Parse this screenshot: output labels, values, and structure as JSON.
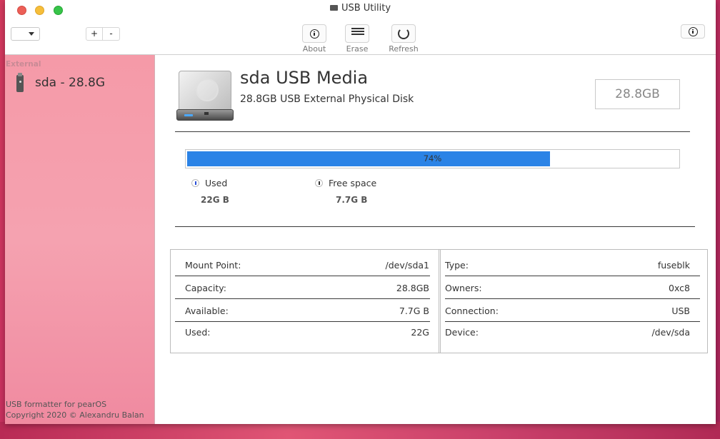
{
  "window": {
    "title": "USB Utility"
  },
  "toolbar": {
    "plus_label": "+",
    "minus_label": "-",
    "about_label": "About",
    "erase_label": "Erase",
    "refresh_label": "Refresh"
  },
  "sidebar": {
    "section_title": "External",
    "devices": [
      {
        "label": "sda - 28.8G"
      }
    ],
    "footer_line1": "USB formatter for pearOS",
    "footer_line2": "Copyright 2020 © Alexandru Balan"
  },
  "disk": {
    "name": "sda USB Media",
    "description": "28.8GB USB External Physical Disk",
    "capacity_badge": "28.8GB",
    "usage_percent": 74,
    "usage_label": "74%",
    "used_label": "Used",
    "used_value": "22G B",
    "free_label": "Free space",
    "free_value": "7.7G B"
  },
  "details": {
    "left": [
      {
        "key": "Mount Point:",
        "value": "/dev/sda1"
      },
      {
        "key": "Capacity:",
        "value": "28.8GB"
      },
      {
        "key": "Available:",
        "value": "7.7G B"
      },
      {
        "key": "Used:",
        "value": "22G"
      }
    ],
    "right": [
      {
        "key": "Type:",
        "value": "fuseblk"
      },
      {
        "key": "Owners:",
        "value": "0xc8"
      },
      {
        "key": "Connection:",
        "value": "USB"
      },
      {
        "key": "Device:",
        "value": "/dev/sda"
      }
    ]
  },
  "colors": {
    "accent": "#2b83e6",
    "sidebar": "#f5a2b0"
  },
  "icons": [
    "drive-icon",
    "info-icon",
    "erase-icon",
    "refresh-icon",
    "usb-drive-icon",
    "hard-disk-icon"
  ]
}
